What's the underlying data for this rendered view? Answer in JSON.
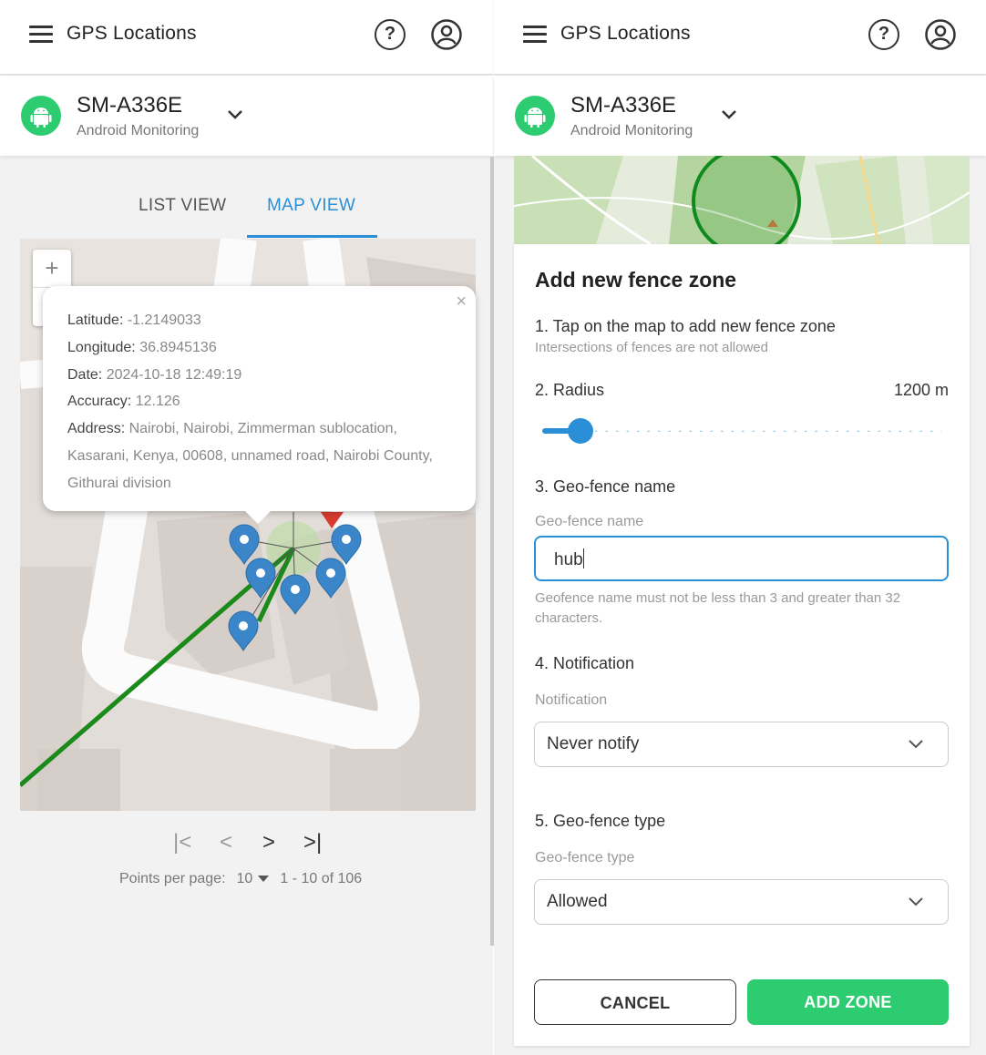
{
  "app": {
    "title": "GPS Locations",
    "help_icon": "question-circle-icon",
    "account_icon": "user-circle-icon"
  },
  "device": {
    "name": "SM-A336E",
    "subtitle": "Android Monitoring",
    "icon": "android-icon",
    "badge_color": "#2ecc71"
  },
  "left": {
    "tabs": [
      {
        "label": "LIST VIEW",
        "active": false
      },
      {
        "label": "MAP VIEW",
        "active": true
      }
    ],
    "zoom": {
      "in_label": "+",
      "out_label": "−"
    },
    "popup": {
      "close_label": "×",
      "rows": [
        {
          "key": "Latitude:",
          "value": "-1.2149033"
        },
        {
          "key": "Longitude:",
          "value": "36.8945136"
        },
        {
          "key": "Date:",
          "value": "2024-10-18 12:49:19"
        },
        {
          "key": "Accuracy:",
          "value": "12.126"
        },
        {
          "key": "Address:",
          "value": "Nairobi, Nairobi, Zimmerman sublocation, Kasarani, Kenya, 00608, unnamed road, Nairobi County, Githurai division"
        }
      ]
    },
    "pager": {
      "points_label": "Points per page:",
      "per_page": "10",
      "range": "1 - 10 of 106"
    }
  },
  "right": {
    "form_title": "Add new fence zone",
    "step1": "1. Tap on the map to add new fence zone",
    "step1_hint": "Intersections of fences are not allowed",
    "step2": "2. Radius",
    "radius_value": "1200 m",
    "radius_fraction": 0.07,
    "step3": "3. Geo-fence name",
    "name_label": "Geo-fence name",
    "name_value": "hub",
    "name_hint": "Geofence name must not be less than 3 and greater than 32 characters.",
    "step4": "4. Notification",
    "notification_label": "Notification",
    "notification_value": "Never notify",
    "step5": "5. Geo-fence type",
    "type_label": "Geo-fence type",
    "type_value": "Allowed",
    "cancel_label": "CANCEL",
    "add_label": "ADD ZONE"
  },
  "colors": {
    "accent": "#2a8fd6",
    "primary_button": "#2ecc71",
    "route": "#1a8a1a",
    "marker": "#3a86c8"
  }
}
